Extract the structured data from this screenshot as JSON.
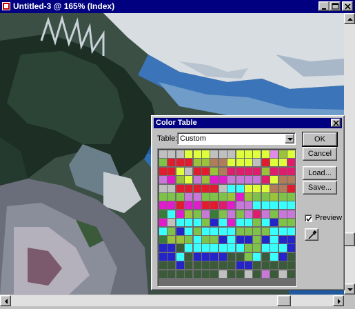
{
  "window": {
    "title": "Untitled-3 @ 165% (Index)",
    "controls": [
      "minimize",
      "maximize",
      "close"
    ]
  },
  "dialog": {
    "title": "Color Table",
    "table_label": "Table:",
    "table_value": "Custom",
    "buttons": {
      "ok": "OK",
      "cancel": "Cancel",
      "load": "Load...",
      "save": "Save..."
    },
    "preview_label": "Preview",
    "preview_checked": true,
    "swatch_columns": 16,
    "swatches": [
      "#c0c0c0",
      "#c0c0c0",
      "#c0c0c0",
      "#dfff3a",
      "#dfff3a",
      "#dfff3a",
      "#c0c0c0",
      "#c0c0c0",
      "#c0c0c0",
      "#dfff3a",
      "#dfff3a",
      "#dfff3a",
      "#dfff3a",
      "#e08be8",
      "#9ac23a",
      "#dfff3a",
      "#7ec24a",
      "#e01c2e",
      "#e01c2e",
      "#e01c2e",
      "#9ac23a",
      "#9ac23a",
      "#b07c5a",
      "#b07c5a",
      "#dfff3a",
      "#dfff3a",
      "#dfff3a",
      "#c0c0c0",
      "#e01c2e",
      "#dfff3a",
      "#dfff3a",
      "#e01c6e",
      "#e01c2e",
      "#e01c2e",
      "#dfff3a",
      "#c0c0c0",
      "#e01c2e",
      "#e01c2e",
      "#9ac23a",
      "#b07c5a",
      "#e01c6e",
      "#e01c6e",
      "#e01c6e",
      "#e01c6e",
      "#9ac23a",
      "#e01c6e",
      "#e01c6e",
      "#e01c6e",
      "#c878d8",
      "#e01ccc",
      "#9ac23a",
      "#dfff3a",
      "#c878d8",
      "#9ac23a",
      "#e01ccc",
      "#e01ccc",
      "#c878d8",
      "#c878d8",
      "#c878d8",
      "#c878d8",
      "#e01c6e",
      "#dfff3a",
      "#b07c5a",
      "#b07c5a",
      "#c0c0c0",
      "#c0c0c0",
      "#e01c2e",
      "#e01c2e",
      "#e01c2e",
      "#e01c2e",
      "#e01c2e",
      "#c0c0c0",
      "#3affff",
      "#3affff",
      "#dfff3a",
      "#dfff3a",
      "#dfff3a",
      "#b07c5a",
      "#b07c5a",
      "#e01c2e",
      "#7ec24a",
      "#7ec24a",
      "#7ec24a",
      "#c878d8",
      "#c878d8",
      "#7ec24a",
      "#7ec24a",
      "#7ec24a",
      "#9ac23a",
      "#e01ccc",
      "#9ac23a",
      "#7ec24a",
      "#7ec24a",
      "#9ac23a",
      "#7ec24a",
      "#7ec24a",
      "#e01ccc",
      "#e01ccc",
      "#e01c2e",
      "#e01ccc",
      "#e01ccc",
      "#e01c2e",
      "#e01c2e",
      "#e01c6e",
      "#e01ccc",
      "#c878d8",
      "#c878d8",
      "#3affff",
      "#3affff",
      "#3affff",
      "#3affff",
      "#3affff",
      "#3a7a3a",
      "#3affff",
      "#e01ccc",
      "#9ac23a",
      "#7ec24a",
      "#c878d8",
      "#3a7a3a",
      "#7ec24a",
      "#c878d8",
      "#7ec24a",
      "#c878d8",
      "#e01c6e",
      "#c878d8",
      "#7ec24a",
      "#c878d8",
      "#c878d8",
      "#e01ccc",
      "#c0c0c0",
      "#3affff",
      "#3affff",
      "#3affff",
      "#7ec24a",
      "#2424c8",
      "#3affff",
      "#e01ccc",
      "#3affff",
      "#3affff",
      "#7ec24a",
      "#3affff",
      "#2424c8",
      "#7ec24a",
      "#7ec24a",
      "#3affff",
      "#7ec24a",
      "#2424c8",
      "#3affff",
      "#7ec24a",
      "#3affff",
      "#3affff",
      "#3affff",
      "#3affff",
      "#7ec24a",
      "#7ec24a",
      "#7ec24a",
      "#7ec24a",
      "#3affff",
      "#3affff",
      "#3affff",
      "#3a7a3a",
      "#9ac23a",
      "#9ac23a",
      "#7ec24a",
      "#3affff",
      "#7ec24a",
      "#7ec24a",
      "#2424c8",
      "#3affff",
      "#2424c8",
      "#2424c8",
      "#7ec24a",
      "#2424c8",
      "#3affff",
      "#2424c8",
      "#2424c8",
      "#2424c8",
      "#2424c8",
      "#3a5a3a",
      "#3affff",
      "#3affff",
      "#3affff",
      "#3affff",
      "#3affff",
      "#3affff",
      "#3affff",
      "#7ec24a",
      "#7ec24a",
      "#3affff",
      "#3affff",
      "#3affff",
      "#2424c8",
      "#2424c8",
      "#2424c8",
      "#3affff",
      "#3a5a3a",
      "#2424c8",
      "#2424c8",
      "#2424c8",
      "#2424c8",
      "#3a5a3a",
      "#3a5a3a",
      "#7ec24a",
      "#3affff",
      "#3a5a3a",
      "#3affff",
      "#2424c8",
      "#3a5a3a",
      "#3a5a3a",
      "#3a5a3a",
      "#2424c8",
      "#3a5a3a",
      "#3a5a3a",
      "#3a5a3a",
      "#3a5a3a",
      "#3a5a3a",
      "#3a5a3a",
      "#2424c8",
      "#2424c8",
      "#3a5a3a",
      "#3a5a3a",
      "#3a5a3a",
      "#3a5a3a",
      "#3a5a3a",
      "#3a5a3a",
      "#3a5a3a",
      "#3a5a3a",
      "#3a5a3a",
      "#3a5a3a",
      "#3a5a3a",
      "#3a5a3a",
      "#c0c0c0",
      "#3a5a3a",
      "#3a5a3a",
      "#c0c0c0",
      "#3a5a3a",
      "#c878d8",
      "#3a5a3a",
      "#c0c0c0",
      "#3a5a3a"
    ]
  },
  "scrollbars": {
    "vertical": "scrollbar",
    "horizontal": "scrollbar"
  },
  "colors": {
    "titlebar": "#000080",
    "face": "#c0c0c0",
    "sky": "#d8dde2",
    "sea": "#3b74b8"
  }
}
